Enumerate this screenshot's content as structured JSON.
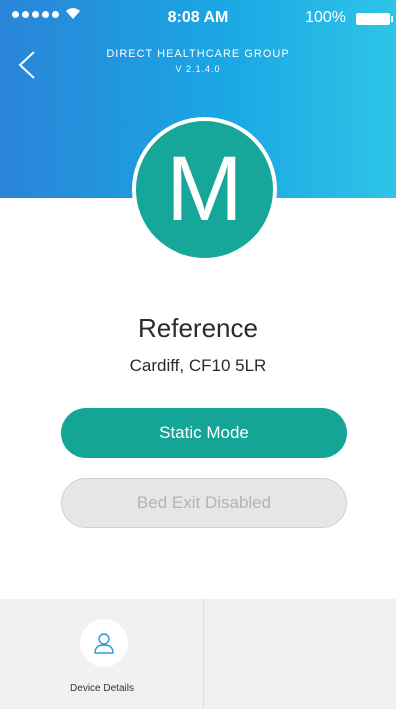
{
  "status_bar": {
    "time": "8:08 AM",
    "battery": "100%"
  },
  "header": {
    "company": "DIRECT HEALTHCARE GROUP",
    "version": "V 2.1.4.0"
  },
  "profile": {
    "initial": "M",
    "name": "Reference",
    "location": "Cardiff, CF10 5LR"
  },
  "buttons": {
    "static_mode": "Static Mode",
    "bed_exit": "Bed Exit Disabled"
  },
  "tabs": [
    {
      "label": "Device Details",
      "icon": "user-icon"
    }
  ],
  "colors": {
    "accent": "#15a597",
    "header_start": "#2a84d8",
    "header_end": "#2ec4e6",
    "disabled": "#e6e6e6"
  }
}
